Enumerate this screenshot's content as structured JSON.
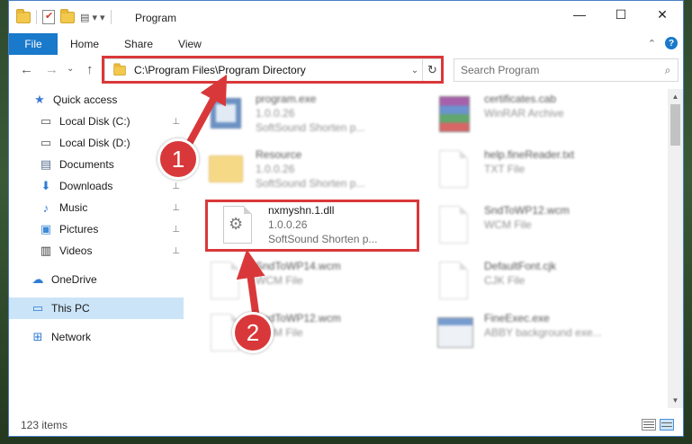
{
  "window": {
    "title": "Program",
    "controls": {
      "minimize": "—",
      "maximize": "☐",
      "close": "✕"
    }
  },
  "ribbon": {
    "file_label": "File",
    "tabs": [
      "Home",
      "Share",
      "View"
    ],
    "help_glyph": "?",
    "collapse_glyph": "⌃"
  },
  "navbar": {
    "back_glyph": "←",
    "forward_glyph": "→",
    "dropdown_glyph": "⌄",
    "up_glyph": "↑",
    "address": "C:\\Program Files\\Program Directory",
    "address_dropdown_glyph": "⌄",
    "refresh_glyph": "↻",
    "search_placeholder": "Search Program",
    "search_glyph": "⌕"
  },
  "sidebar": {
    "items": [
      {
        "label": "Quick access",
        "icon": "star-icon",
        "glyph": "★",
        "color": "#3a7bd5",
        "pinned": false
      },
      {
        "label": "Local Disk (C:)",
        "icon": "drive-icon",
        "glyph": "▭",
        "color": "#555555",
        "pinned": true
      },
      {
        "label": "Local Disk (D:)",
        "icon": "drive-icon",
        "glyph": "▭",
        "color": "#555555",
        "pinned": false
      },
      {
        "label": "Documents",
        "icon": "document-icon",
        "glyph": "▤",
        "color": "#5a6f8f",
        "pinned": true
      },
      {
        "label": "Downloads",
        "icon": "download-icon",
        "glyph": "⬇",
        "color": "#2f7cd6",
        "pinned": true
      },
      {
        "label": "Music",
        "icon": "music-icon",
        "glyph": "♪",
        "color": "#2f7cd6",
        "pinned": true
      },
      {
        "label": "Pictures",
        "icon": "pictures-icon",
        "glyph": "▣",
        "color": "#3f8ad8",
        "pinned": true
      },
      {
        "label": "Videos",
        "icon": "video-icon",
        "glyph": "▥",
        "color": "#3a3a3a",
        "pinned": true
      },
      {
        "label": "OneDrive",
        "icon": "cloud-icon",
        "glyph": "☁",
        "color": "#2f7cd6",
        "pinned": false
      },
      {
        "label": "This PC",
        "icon": "computer-icon",
        "glyph": "▭",
        "color": "#2f7cd6",
        "pinned": false,
        "selected": true
      },
      {
        "label": "Network",
        "icon": "network-icon",
        "glyph": "⊞",
        "color": "#2f7cd6",
        "pinned": false
      }
    ],
    "pin_glyph": "📌"
  },
  "files": [
    {
      "name": "program.exe",
      "line2": "1.0.0.26",
      "line3": "SoftSound Shorten p...",
      "icon": "exe-icon",
      "blurred": true
    },
    {
      "name": "certificates.cab",
      "line2": "WinRAR Archive",
      "line3": "",
      "icon": "winrar-icon",
      "blurred": true
    },
    {
      "name": "Resource",
      "line2": "1.0.0.26",
      "line3": "SoftSound Shorten p...",
      "icon": "folder-icon",
      "blurred": true
    },
    {
      "name": "help.fineReader.txt",
      "line2": "TXT File",
      "line3": "",
      "icon": "text-file-icon",
      "blurred": true
    },
    {
      "name": "nxmyshn.1.dll",
      "line2": "1.0.0.26",
      "line3": "SoftSound Shorten p...",
      "icon": "dll-gear-icon",
      "blurred": false
    },
    {
      "name": "SndToWP12.wcm",
      "line2": "WCM File",
      "line3": "",
      "icon": "file-icon",
      "blurred": true
    },
    {
      "name": "SndToWP14.wcm",
      "line2": "WCM File",
      "line3": "",
      "icon": "file-icon",
      "blurred": true
    },
    {
      "name": "DefaultFont.cjk",
      "line2": "CJK File",
      "line3": "",
      "icon": "file-icon",
      "blurred": true
    },
    {
      "name": "SndToWP12.wcm",
      "line2": "WCM File",
      "line3": "",
      "icon": "file-icon",
      "blurred": true
    },
    {
      "name": "FineExec.exe",
      "line2": "ABBY background exe...",
      "line3": "",
      "icon": "window-icon",
      "blurred": true
    }
  ],
  "annotations": {
    "step1": "1",
    "step2": "2",
    "color": "#d9383a"
  },
  "status": {
    "item_count": "123 items"
  }
}
